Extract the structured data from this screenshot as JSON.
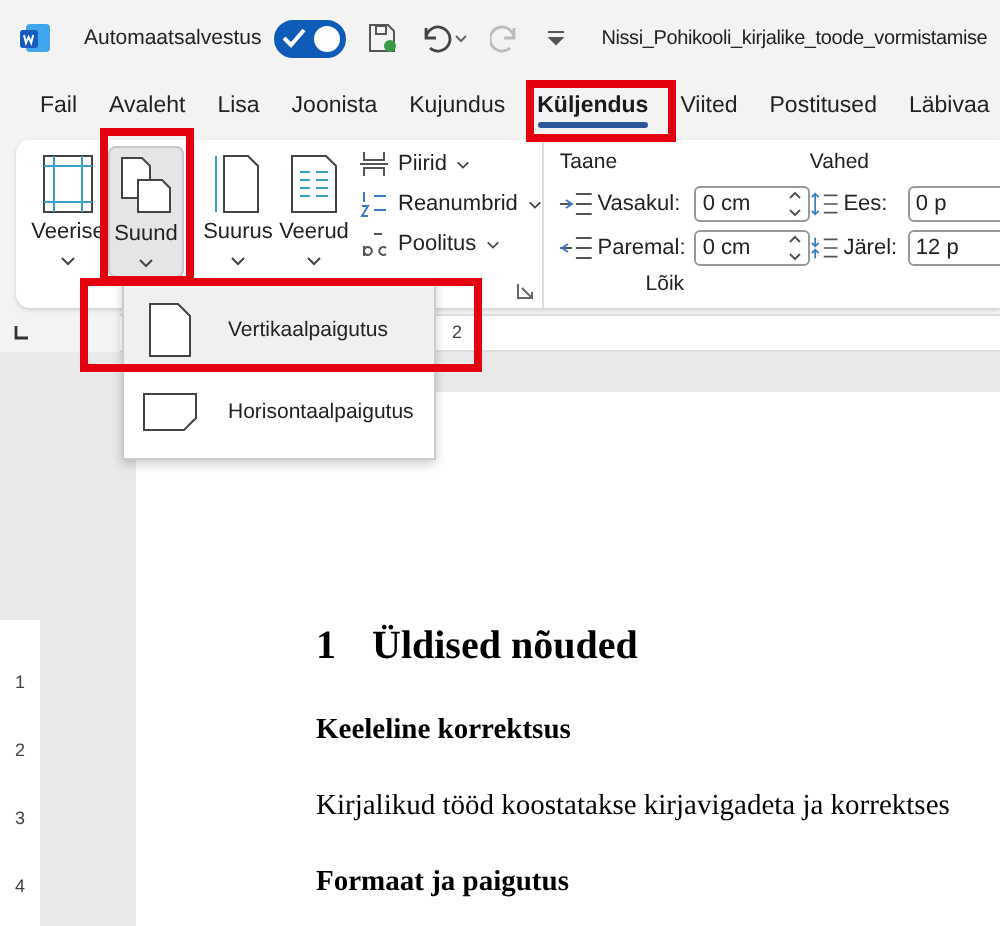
{
  "title_bar": {
    "autosave_label": "Automaatsalvestus",
    "autosave_on": true,
    "document_name": "Nissi_Pohikooli_kirjalike_toode_vormistamise"
  },
  "tabs": [
    {
      "label": "Fail",
      "selected": false
    },
    {
      "label": "Avaleht",
      "selected": false
    },
    {
      "label": "Lisa",
      "selected": false
    },
    {
      "label": "Joonista",
      "selected": false
    },
    {
      "label": "Kujundus",
      "selected": false
    },
    {
      "label": "Küljendus",
      "selected": true
    },
    {
      "label": "Viited",
      "selected": false
    },
    {
      "label": "Postitused",
      "selected": false
    },
    {
      "label": "Läbivaa",
      "selected": false
    }
  ],
  "ribbon": {
    "large_buttons": [
      {
        "label": "Veerise",
        "kind": "margins",
        "pressed": false
      },
      {
        "label": "Suund",
        "kind": "orientation",
        "pressed": true
      },
      {
        "label": "Suurus",
        "kind": "size",
        "pressed": false
      },
      {
        "label": "Veerud",
        "kind": "columns",
        "pressed": false
      }
    ],
    "small_buttons": [
      {
        "label": "Piirid",
        "kind": "breaks"
      },
      {
        "label": "Reanumbrid",
        "kind": "line_numbers"
      },
      {
        "label": "Poolitus",
        "kind": "hyphenation"
      }
    ],
    "indent": {
      "title": "Taane",
      "rows": [
        {
          "label": "Vasakul:",
          "value": "0 cm",
          "kind": "left"
        },
        {
          "label": "Paremal:",
          "value": "0 cm",
          "kind": "right"
        }
      ]
    },
    "spacing": {
      "title": "Vahed",
      "rows": [
        {
          "label": "Ees:",
          "value": "0 p",
          "kind": "before"
        },
        {
          "label": "Järel:",
          "value": "12 p",
          "kind": "after"
        }
      ]
    },
    "group_label": "Lõik"
  },
  "orientation_menu": [
    {
      "label": "Vertikaalpaigutus",
      "kind": "portrait",
      "selected": true
    },
    {
      "label": "Horisontaalpaigutus",
      "kind": "landscape",
      "selected": false
    }
  ],
  "ruler": {
    "horizontal": [
      "2"
    ],
    "vertical": [
      "1",
      "2",
      "3",
      "4"
    ]
  },
  "document": [
    {
      "kind": "heading1",
      "number": "1",
      "text": "Üldised nõuded"
    },
    {
      "kind": "heading3",
      "text": "Keeleline korrektsus"
    },
    {
      "kind": "paragraph",
      "text": "Kirjalikud tööd koostatakse kirjavigadeta ja korrektses"
    },
    {
      "kind": "heading3",
      "text": "Formaat ja paigutus"
    }
  ]
}
